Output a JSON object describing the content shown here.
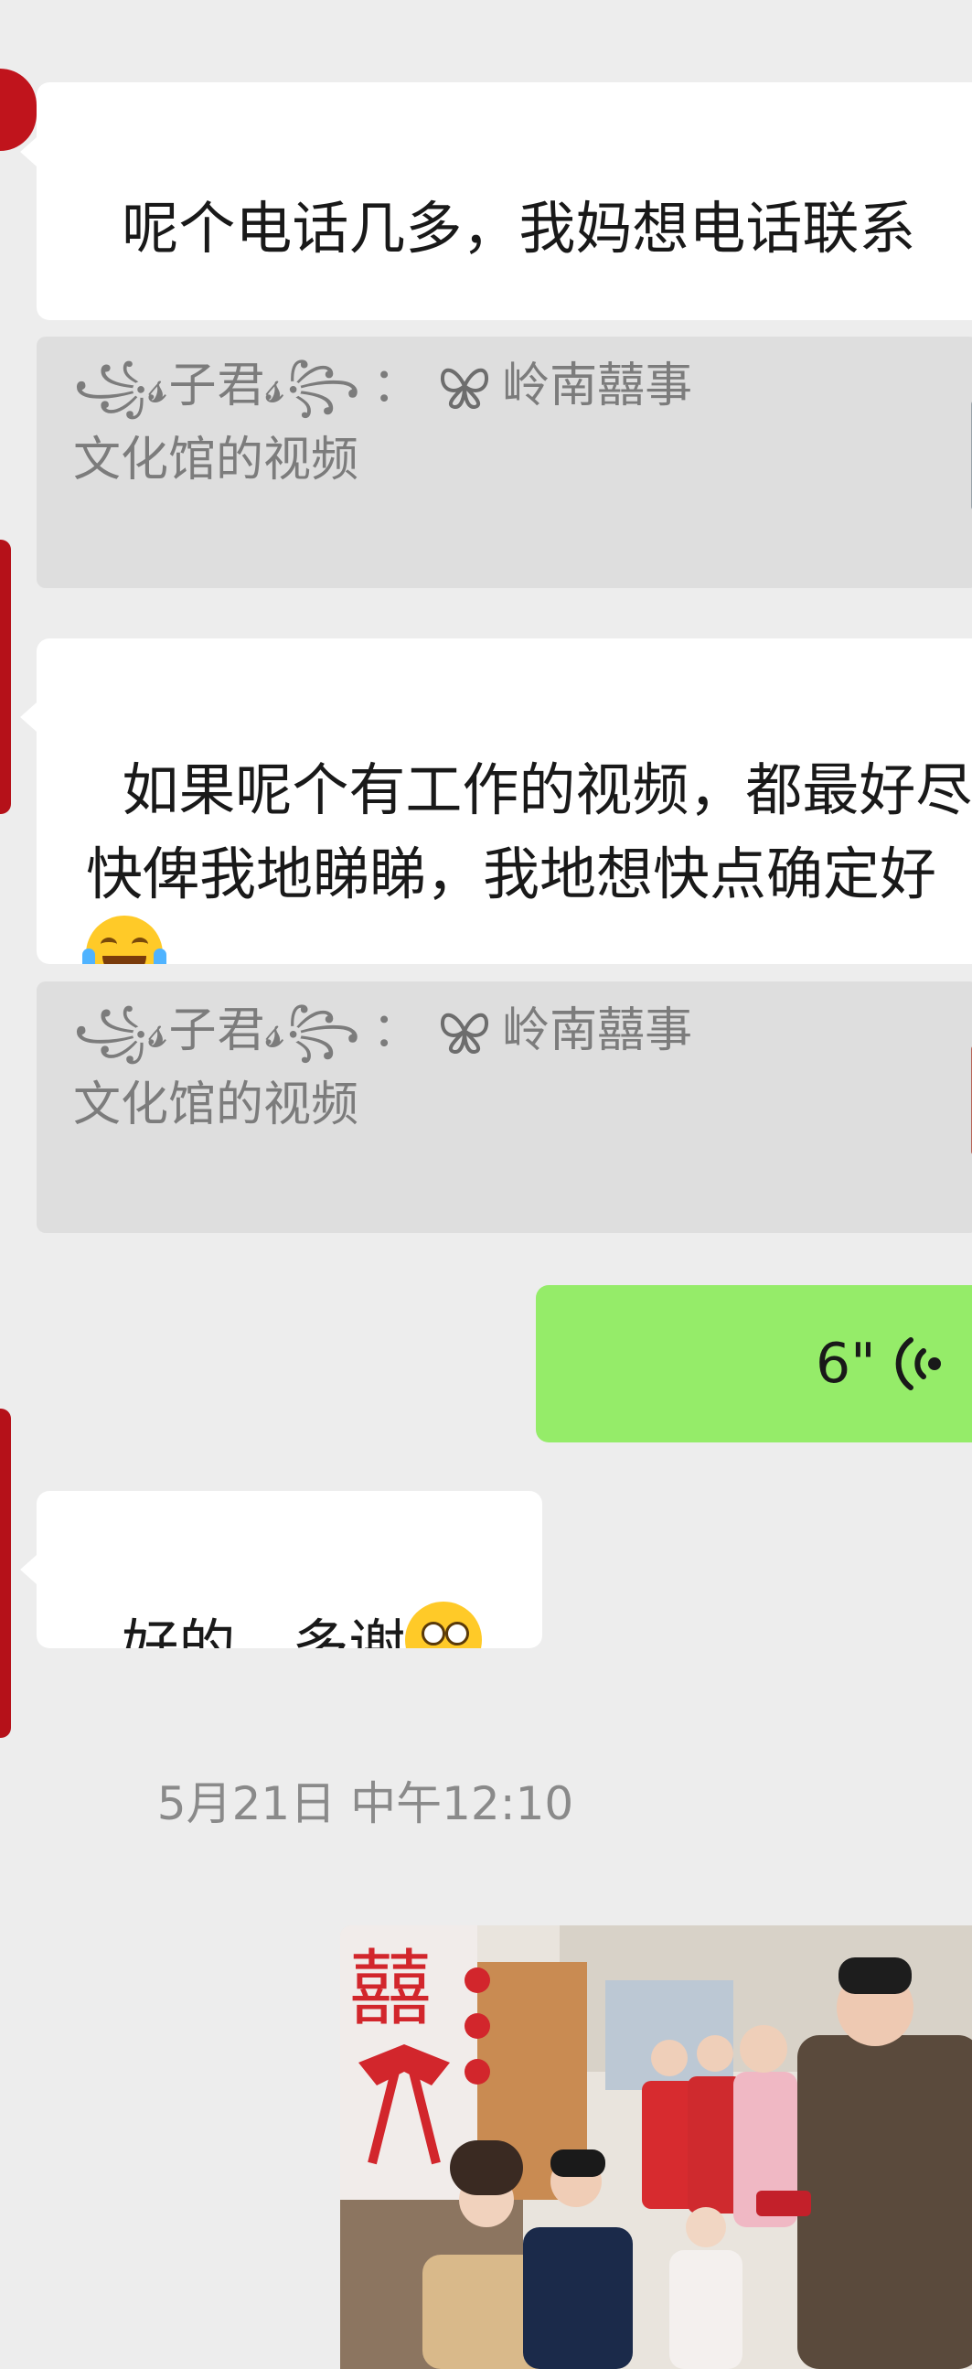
{
  "messages": {
    "msg1": "呢个电话几多，我妈想电话联系",
    "quote1": {
      "sender": "꧁𝓼子君𝓼꧂",
      "colon": "：",
      "source": "岭南囍事",
      "title": "文化馆的视频"
    },
    "msg2": "如果呢个有工作的视频，都最好尽快俾我地睇睇，我地想快点确定好",
    "quote2": {
      "sender": "꧁𝓼子君𝓼꧂",
      "colon": "：",
      "source": "岭南囍事",
      "title": "文化馆的视频"
    },
    "voice": {
      "duration": "6\""
    },
    "msg3": "好的，多谢"
  },
  "timestamp": "5月21日 中午12:10",
  "icons": {
    "brand": "butterfly-icon",
    "voice": "voice-wave-icon",
    "emoji_laugh": "tears-of-joy-emoji",
    "emoji_think": "thinking-emoji"
  },
  "colors": {
    "background": "#ededed",
    "incoming_bubble": "#ffffff",
    "outgoing_bubble": "#95ec69",
    "quote_bg": "#dedede",
    "avatar_red": "#c0141c"
  }
}
